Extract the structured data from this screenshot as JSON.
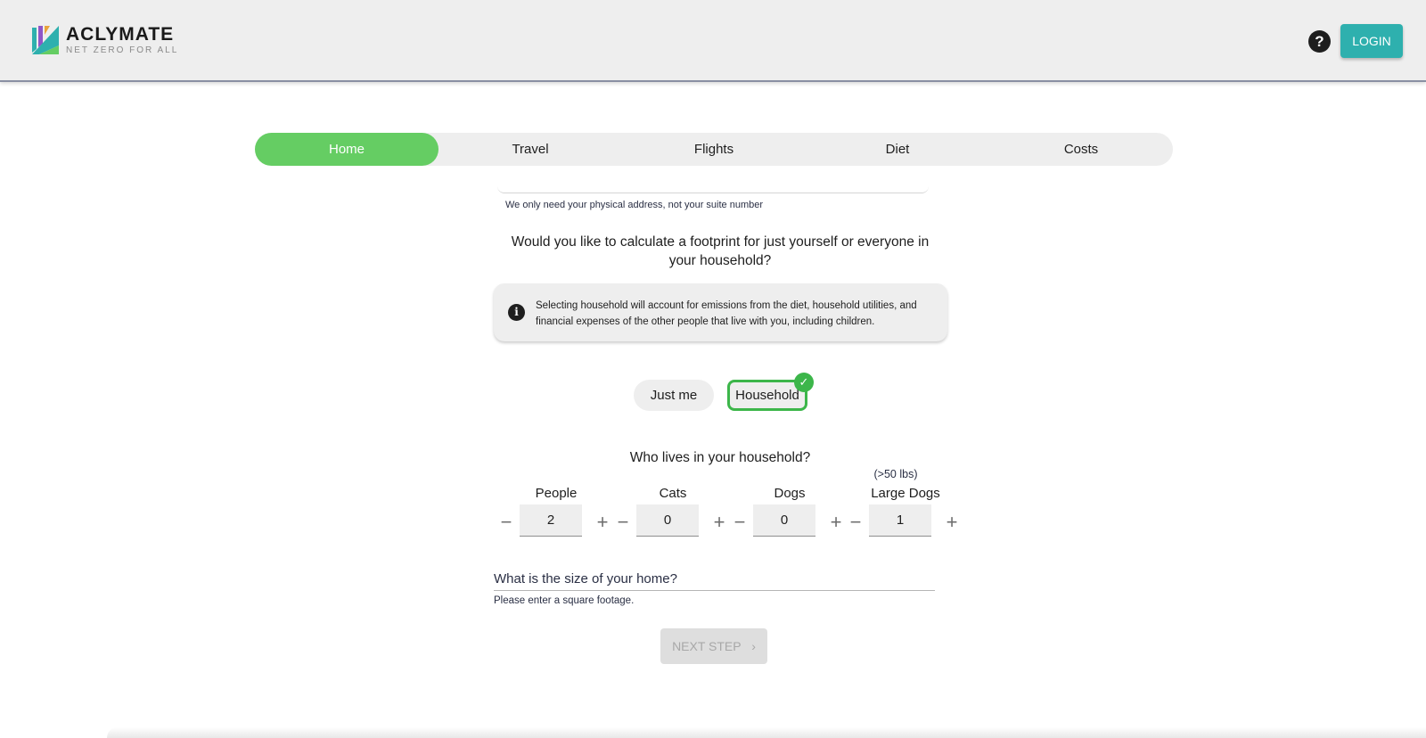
{
  "header": {
    "logo_name": "ACLYMATE",
    "logo_tagline": "NET ZERO FOR ALL",
    "help_label": "?",
    "login_label": "LOGIN"
  },
  "tabs": [
    {
      "label": "Home",
      "active": true
    },
    {
      "label": "Travel",
      "active": false
    },
    {
      "label": "Flights",
      "active": false
    },
    {
      "label": "Diet",
      "active": false
    },
    {
      "label": "Costs",
      "active": false
    }
  ],
  "address_hint": "We only need your physical address, not your suite number",
  "footprint_question": "Would you like to calculate a footprint for just yourself or everyone in your household?",
  "info": {
    "icon": "info-icon",
    "text": "Selecting household will account for emissions from the diet, household utilities, and financial expenses of the other people that live with you, including children."
  },
  "choices": {
    "just_me": "Just me",
    "household": "Household",
    "selected": "Household"
  },
  "household_question": "Who lives in your household?",
  "counters": [
    {
      "label": "People",
      "value": "2"
    },
    {
      "label": "Cats",
      "value": "0"
    },
    {
      "label": "Dogs",
      "value": "0"
    },
    {
      "label": "Large Dogs",
      "value": "1",
      "note": "(>50 lbs)"
    }
  ],
  "home_size": {
    "placeholder": "What is the size of your home?",
    "hint": "Please enter a square footage."
  },
  "next_step_label": "NEXT STEP",
  "colors": {
    "accent_green": "#65cd63",
    "selected_border": "#3cb64a",
    "login_teal": "#2eb0ae"
  }
}
